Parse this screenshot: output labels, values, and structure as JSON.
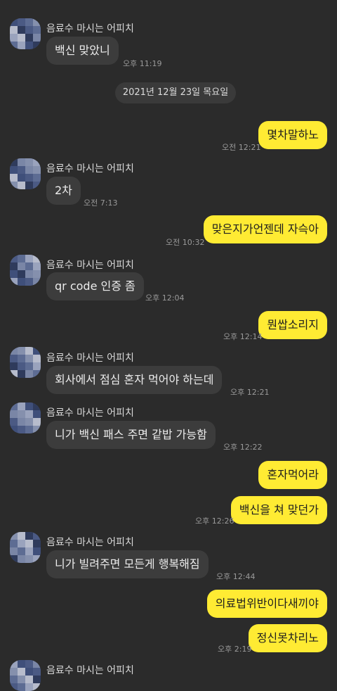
{
  "sender": "음료수 마시는 어피치",
  "messages": [
    {
      "side": "in",
      "text": "백신 맞았니",
      "time": "오후 11:19",
      "show_name": true
    },
    {
      "type": "date",
      "text": "2021년 12월 23일 목요일"
    },
    {
      "side": "out",
      "text": "몇차말하노",
      "time": "오전 12:21"
    },
    {
      "side": "in",
      "text": "2차",
      "time": "오전 7:13",
      "show_name": true
    },
    {
      "side": "out",
      "text": "맞은지가언젠데 자슥아",
      "time": "오전 10:32"
    },
    {
      "side": "in",
      "text": "qr code 인증 좀",
      "time": "오후 12:04",
      "show_name": true
    },
    {
      "side": "out",
      "text": "뭔쌉소리지",
      "time": "오후 12:14"
    },
    {
      "side": "in",
      "text": "회사에서 점심 혼자 먹어야 하는데",
      "time": "오후 12:21",
      "show_name": true
    },
    {
      "side": "in",
      "text": "니가 백신 패스 주면 같밥 가능함",
      "time": "오후 12:22",
      "show_name": true
    },
    {
      "side": "out",
      "text": "혼자먹어라",
      "time": ""
    },
    {
      "side": "out",
      "text": "백신을 쳐 맞던가",
      "time": "오후 12:26"
    },
    {
      "side": "in",
      "text": "니가 빌려주면 모든게 행복해짐",
      "time": "오후 12:44",
      "show_name": true
    },
    {
      "side": "out",
      "text": "의료법위반이다새끼야",
      "time": ""
    },
    {
      "side": "out",
      "text": "정신못차리노",
      "time": "오후 2:19"
    },
    {
      "side": "in",
      "text": "",
      "time": "",
      "show_name": true,
      "partial": true
    }
  ]
}
